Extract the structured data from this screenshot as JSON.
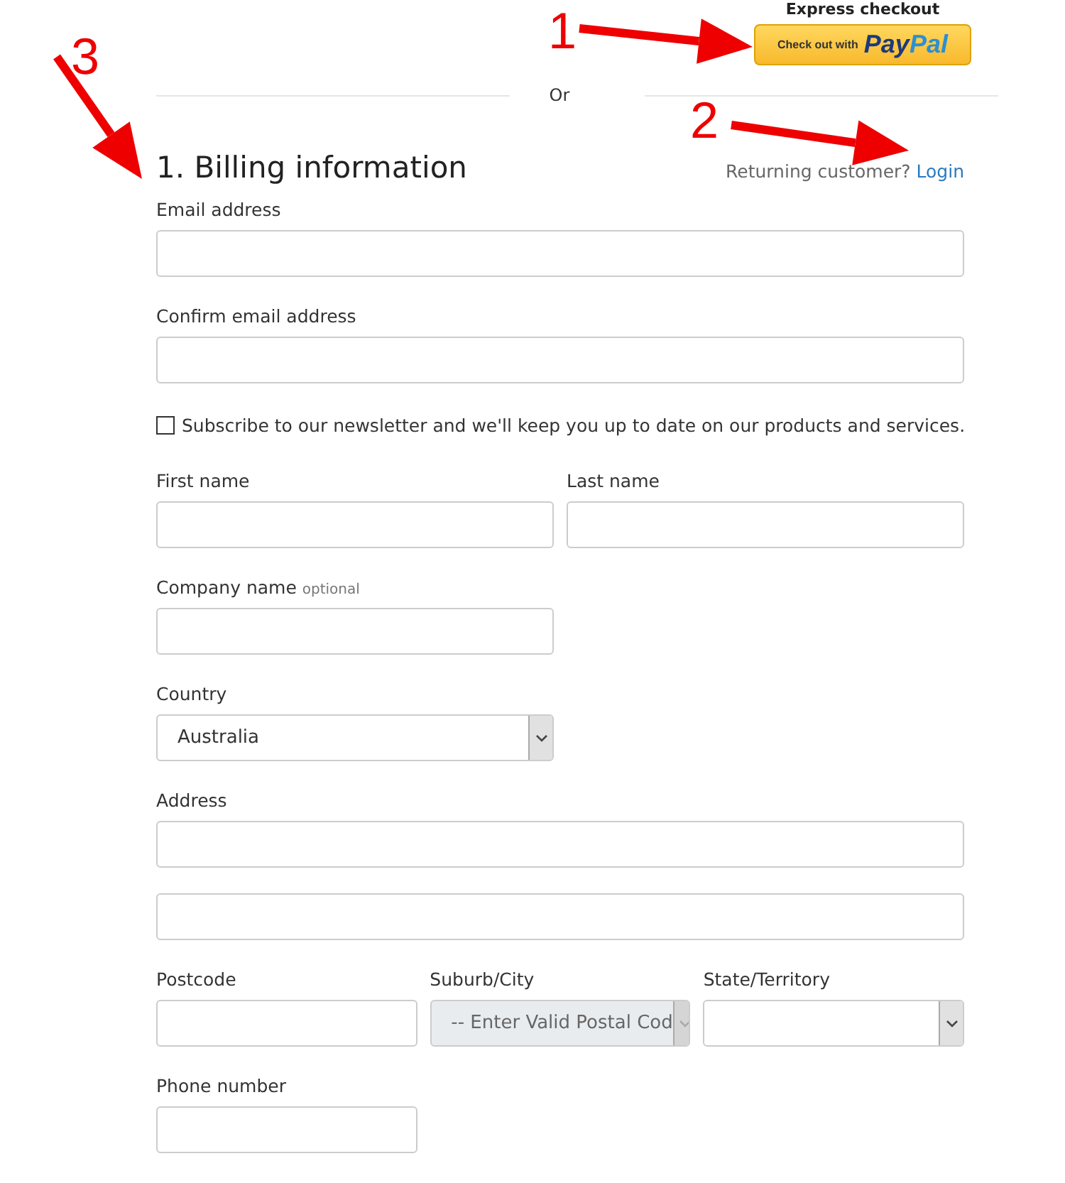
{
  "express": {
    "title": "Express checkout",
    "button": {
      "prefix": "Check out with",
      "brand_a": "Pay",
      "brand_b": "Pal"
    },
    "separator": "Or"
  },
  "billing": {
    "heading": "1. Billing information",
    "returning": "Returning customer?",
    "login": "Login"
  },
  "rows": [
    {
      "fields": [
        {
          "kind": "text",
          "label": "Email address"
        }
      ]
    },
    {
      "fields": [
        {
          "kind": "text",
          "label": "Confirm email address"
        }
      ]
    },
    {
      "fields": [
        {
          "kind": "checkbox",
          "label": "Subscribe to our newsletter and we'll keep you up to date on our products and services.",
          "checked": false
        }
      ]
    },
    {
      "fields": [
        {
          "kind": "text",
          "label": "First name"
        },
        {
          "kind": "text",
          "label": "Last name"
        }
      ]
    },
    {
      "fields": [
        {
          "kind": "text",
          "label": "Company name",
          "hint": "optional"
        },
        {
          "kind": "spacer"
        }
      ]
    },
    {
      "fields": [
        {
          "kind": "select",
          "label": "Country",
          "value": "Australia",
          "disabled": false
        },
        {
          "kind": "spacer"
        }
      ]
    },
    {
      "fields": [
        {
          "kind": "text",
          "label": "Address"
        }
      ]
    },
    {
      "fields": [
        {
          "kind": "text"
        }
      ]
    },
    {
      "fields": [
        {
          "kind": "text",
          "label": "Postcode"
        },
        {
          "kind": "select",
          "label": "Suburb/City",
          "value": "-- Enter Valid Postal Cod",
          "disabled": true
        },
        {
          "kind": "select",
          "label": "State/Territory",
          "disabled": false
        }
      ]
    },
    {
      "fields": [
        {
          "kind": "text",
          "label": "Phone number"
        },
        {
          "kind": "spacer"
        },
        {
          "kind": "spacer"
        }
      ]
    }
  ],
  "annotations": [
    {
      "label": "1"
    },
    {
      "label": "2"
    },
    {
      "label": "3"
    }
  ]
}
